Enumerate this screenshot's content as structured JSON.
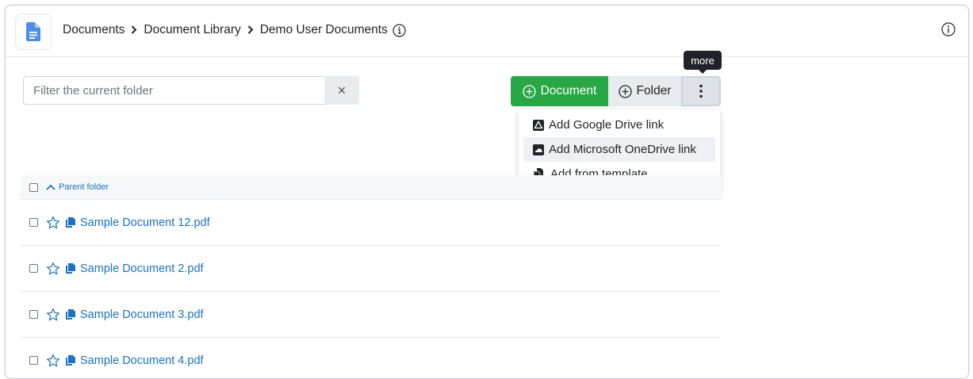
{
  "header": {
    "app_icon": "document-icon",
    "breadcrumb": [
      "Documents",
      "Document Library",
      "Demo User Documents"
    ],
    "separator": ">"
  },
  "filter": {
    "placeholder": "Filter the current folder",
    "value": "",
    "clear_label": "×"
  },
  "toolbar": {
    "document_label": "Document",
    "folder_label": "Folder",
    "more_tooltip": "more"
  },
  "menu": {
    "items": [
      {
        "label": "Add Google Drive link",
        "icon": "google-drive-icon"
      },
      {
        "label": "Add Microsoft OneDrive link",
        "icon": "onedrive-icon",
        "highlighted": true
      },
      {
        "label": "Add from template",
        "icon": "template-icon"
      }
    ]
  },
  "list": {
    "parent_label": "Parent folder",
    "rows": [
      {
        "name": "Sample Document 12.pdf"
      },
      {
        "name": "Sample Document 2.pdf"
      },
      {
        "name": "Sample Document 3.pdf"
      },
      {
        "name": "Sample Document 4.pdf"
      }
    ]
  },
  "colors": {
    "primary_green": "#28a745",
    "link_blue": "#1a73c8",
    "app_icon_blue": "#4a8fe7"
  }
}
